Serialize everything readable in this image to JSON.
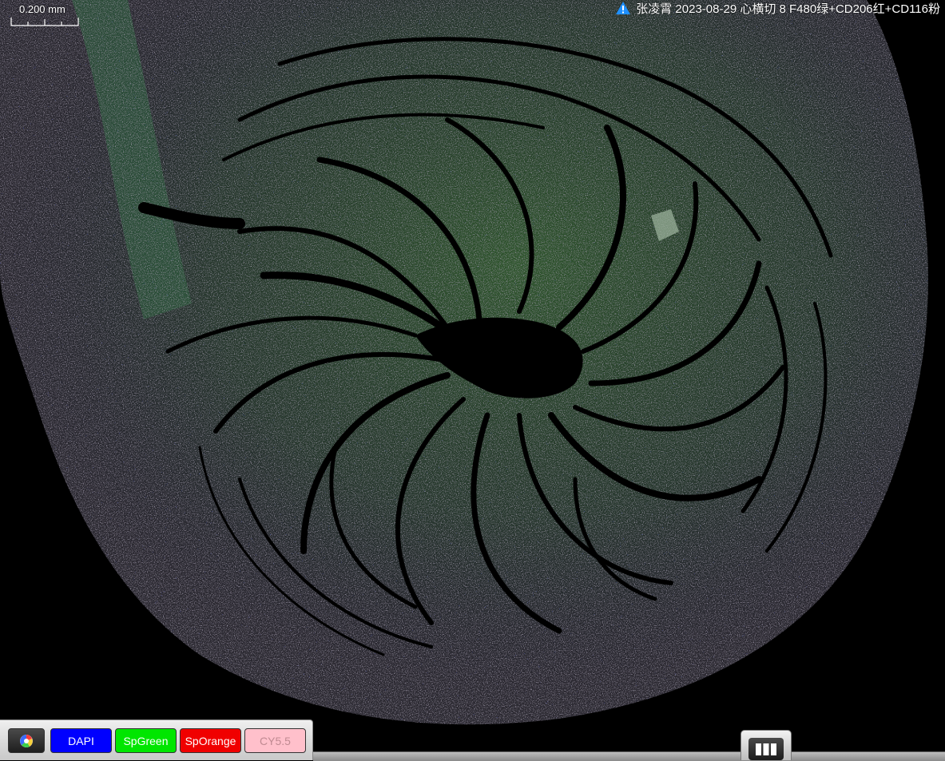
{
  "scalebar": {
    "label": "0.200 mm"
  },
  "title": {
    "text": "张凌霄 2023-08-29 心横切 8 F480绿+CD206红+CD116粉"
  },
  "channels": {
    "items": [
      {
        "label": "DAPI",
        "color": "#0000ff"
      },
      {
        "label": "SpGreen",
        "color": "#00e600"
      },
      {
        "label": "SpOrange",
        "color": "#f00000"
      },
      {
        "label": "CY5.5",
        "color": "#ffc0cb"
      }
    ]
  },
  "icons": {
    "warning": "warning-icon",
    "color_toggle": "color-wheel-icon",
    "layout": "layout-grid-icon"
  }
}
